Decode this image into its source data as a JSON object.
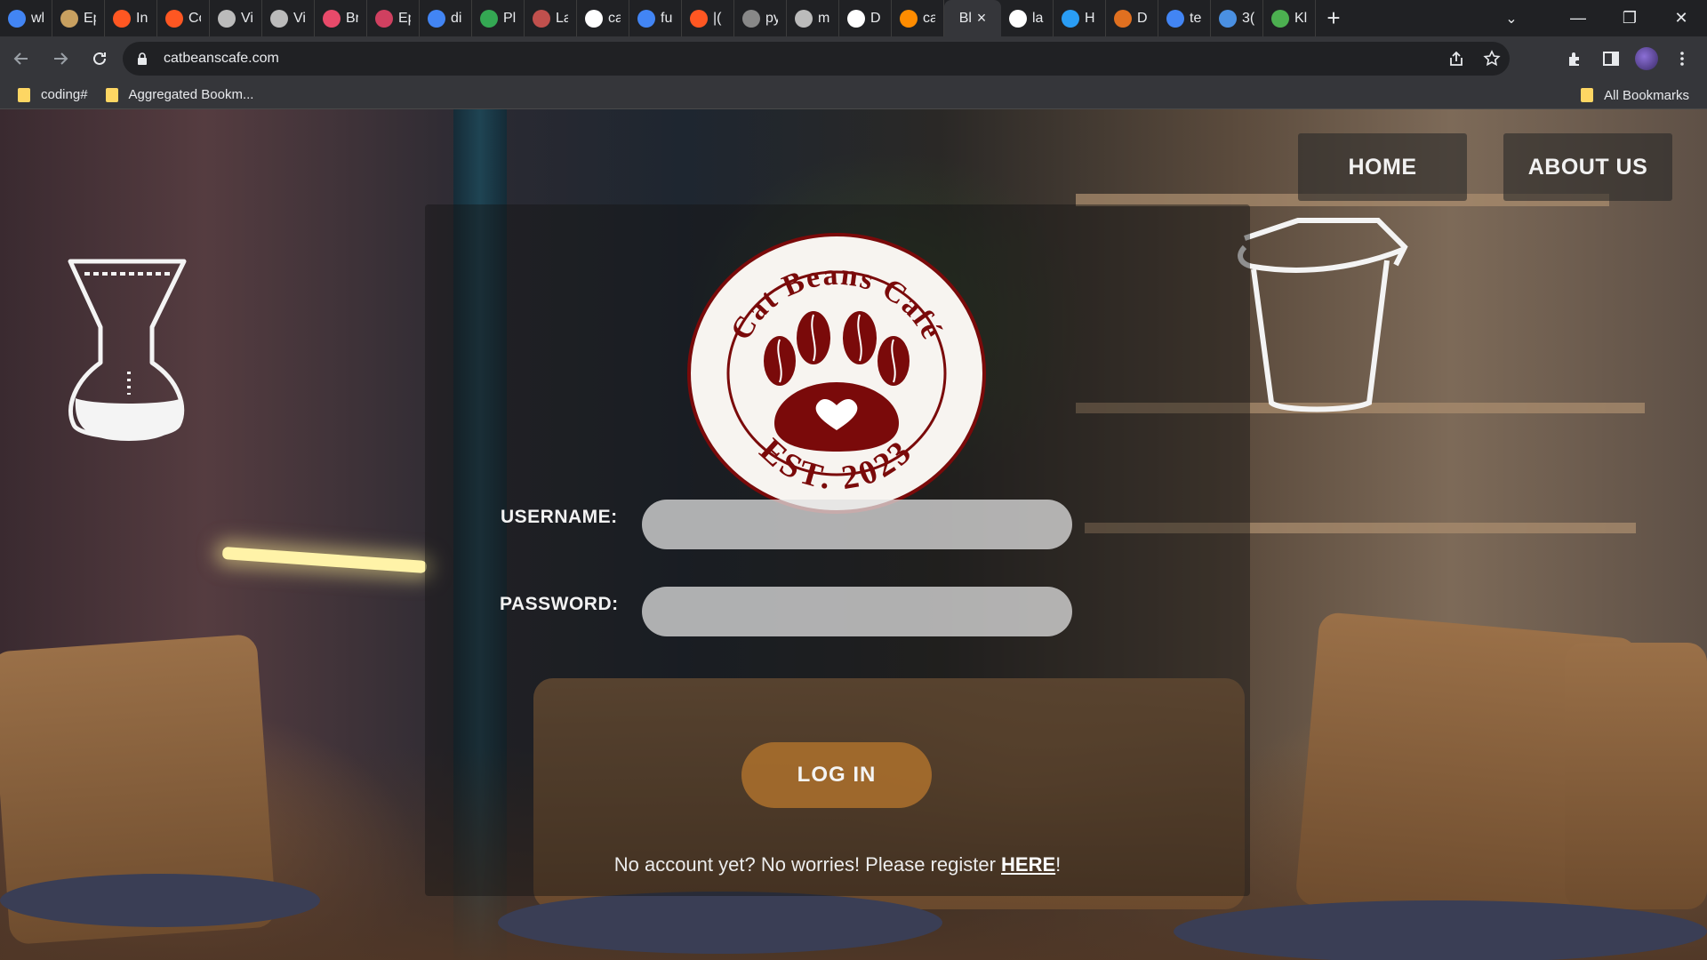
{
  "browser": {
    "tabs": [
      {
        "title": "wl",
        "fav": "#4285f4"
      },
      {
        "title": "Ep",
        "fav": "#c8a060"
      },
      {
        "title": "In",
        "fav": "#ff5722"
      },
      {
        "title": "Cc",
        "fav": "#ff5722"
      },
      {
        "title": "Vi",
        "fav": "#bbbbbb"
      },
      {
        "title": "Vi",
        "fav": "#bbbbbb"
      },
      {
        "title": "Br",
        "fav": "#e84a6a"
      },
      {
        "title": "Ep",
        "fav": "#d04060"
      },
      {
        "title": "di",
        "fav": "#4285f4"
      },
      {
        "title": "Pl",
        "fav": "#34a853"
      },
      {
        "title": "La",
        "fav": "#c0504d"
      },
      {
        "title": "ca",
        "fav": "#ffffff"
      },
      {
        "title": "fu",
        "fav": "#4285f4"
      },
      {
        "title": "|(",
        "fav": "#ff5722"
      },
      {
        "title": "py",
        "fav": "#888888"
      },
      {
        "title": "m",
        "fav": "#bbbbbb"
      },
      {
        "title": "D",
        "fav": "#ffffff"
      },
      {
        "title": "ca",
        "fav": "#ff8c00"
      },
      {
        "title": "Bl",
        "fav": "",
        "active": true
      },
      {
        "title": "la",
        "fav": "#ffffff"
      },
      {
        "title": "H",
        "fav": "#2a9df4"
      },
      {
        "title": "D",
        "fav": "#e07020"
      },
      {
        "title": "te",
        "fav": "#4285f4"
      },
      {
        "title": "3(",
        "fav": "#4a90e2"
      },
      {
        "title": "Kl",
        "fav": "#4caf50"
      }
    ],
    "tab_close": "×",
    "new_tab": "+",
    "tab_list": "⌄",
    "window_controls": {
      "minimize": "—",
      "maximize": "❐",
      "close": "✕"
    },
    "url": "catbeanscafe.com",
    "bookmarks": [
      "coding#",
      "Aggregated Bookm..."
    ],
    "bookmarks_right": "All Bookmarks"
  },
  "nav": {
    "home": "HOME",
    "about": "ABOUT US"
  },
  "logo": {
    "top_text": "Cat Beans Café",
    "bottom_text": "EST. 2023",
    "color": "#7a0a0a"
  },
  "login": {
    "username_label": "USERNAME:",
    "password_label": "PASSWORD:",
    "username_value": "",
    "password_value": "",
    "button": "LOG IN",
    "register_prefix": "No account yet? No worries! Please register ",
    "register_link": "HERE",
    "register_suffix": "!"
  }
}
